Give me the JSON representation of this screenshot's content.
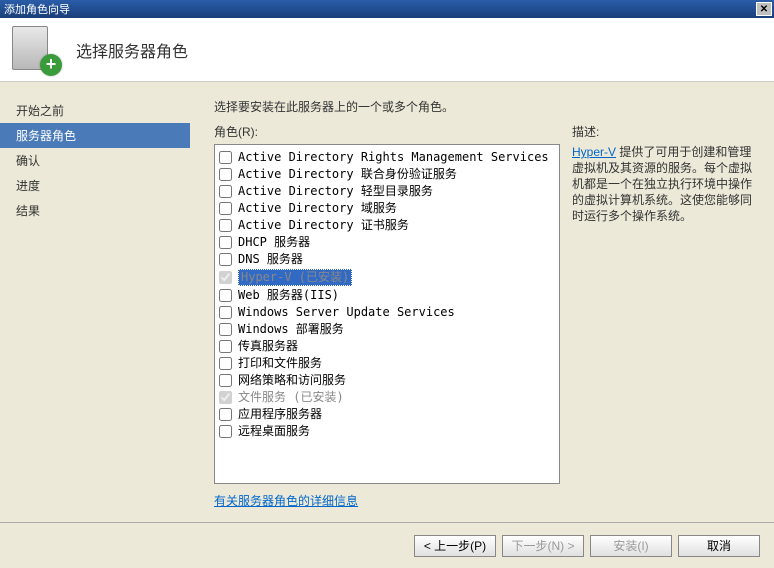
{
  "window": {
    "title": "添加角色向导"
  },
  "header": {
    "title": "选择服务器角色"
  },
  "sidebar": {
    "items": [
      {
        "label": "开始之前"
      },
      {
        "label": "服务器角色"
      },
      {
        "label": "确认"
      },
      {
        "label": "进度"
      },
      {
        "label": "结果"
      }
    ],
    "activeIndex": 1
  },
  "main": {
    "instruction": "选择要安装在此服务器上的一个或多个角色。",
    "rolesLabel": "角色(R):",
    "descLabel": "描述:",
    "roles": [
      {
        "label": "Active Directory Rights Management Services",
        "checked": false,
        "disabled": false
      },
      {
        "label": "Active Directory 联合身份验证服务",
        "checked": false,
        "disabled": false
      },
      {
        "label": "Active Directory 轻型目录服务",
        "checked": false,
        "disabled": false
      },
      {
        "label": "Active Directory 域服务",
        "checked": false,
        "disabled": false
      },
      {
        "label": "Active Directory 证书服务",
        "checked": false,
        "disabled": false
      },
      {
        "label": "DHCP 服务器",
        "checked": false,
        "disabled": false
      },
      {
        "label": "DNS 服务器",
        "checked": false,
        "disabled": false
      },
      {
        "label": "Hyper-V  (已安装)",
        "checked": true,
        "disabled": true,
        "selected": true
      },
      {
        "label": "Web 服务器(IIS)",
        "checked": false,
        "disabled": false
      },
      {
        "label": "Windows Server Update Services",
        "checked": false,
        "disabled": false
      },
      {
        "label": "Windows 部署服务",
        "checked": false,
        "disabled": false
      },
      {
        "label": "传真服务器",
        "checked": false,
        "disabled": false
      },
      {
        "label": "打印和文件服务",
        "checked": false,
        "disabled": false
      },
      {
        "label": "网络策略和访问服务",
        "checked": false,
        "disabled": false
      },
      {
        "label": "文件服务  (已安装)",
        "checked": true,
        "disabled": true
      },
      {
        "label": "应用程序服务器",
        "checked": false,
        "disabled": false
      },
      {
        "label": "远程桌面服务",
        "checked": false,
        "disabled": false
      }
    ],
    "description": {
      "link": "Hyper-V",
      "text": " 提供了可用于创建和管理虚拟机及其资源的服务。每个虚拟机都是一个在独立执行环境中操作的虚拟计算机系统。这使您能够同时运行多个操作系统。"
    },
    "moreInfoLink": "有关服务器角色的详细信息"
  },
  "footer": {
    "prev": "< 上一步(P)",
    "next": "下一步(N) >",
    "install": "安装(I)",
    "cancel": "取消"
  }
}
